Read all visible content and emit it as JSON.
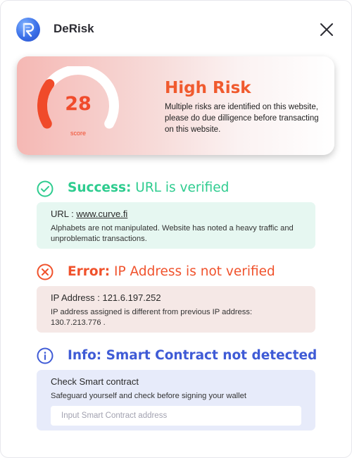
{
  "app": {
    "title": "DeRisk",
    "logo_icon": "derisk-logo-icon",
    "close_icon": "close-icon"
  },
  "risk": {
    "score": "28",
    "score_value": 28,
    "score_max": 100,
    "score_label": "score",
    "level": "High Risk",
    "description": "Multiple risks are identified on this website, please do due dilligence before transacting on this website.",
    "color": "#f05a2e"
  },
  "checks": {
    "url": {
      "icon": "check-circle-icon",
      "status": "Success:",
      "message": " URL is verified",
      "color": "#2ecc8f",
      "detail_label": "URL : ",
      "detail_value": "www.curve.fi",
      "detail_text": "Alphabets are not manipulated. Website has noted a heavy traffic and unproblematic transactions.",
      "box_color": "#e6f7f1"
    },
    "ip": {
      "icon": "x-circle-icon",
      "status": "Error:",
      "message": " IP Address is not verified",
      "color": "#f0522c",
      "detail_label": "IP Address : 121.6.197.252",
      "detail_text": "IP address assigned is different from previous IP address: 130.7.213.776 .",
      "box_color": "#f5e8e6"
    },
    "contract": {
      "icon": "info-circle-icon",
      "status": "Info: Smart Contract not detected",
      "color": "#3f5bd6",
      "detail_label": "Check Smart contract",
      "detail_text": "Safeguard yourself and check before signing your wallet",
      "input_placeholder": "Input Smart Contract address",
      "input_value": "",
      "box_color": "#e7ebfa"
    }
  }
}
